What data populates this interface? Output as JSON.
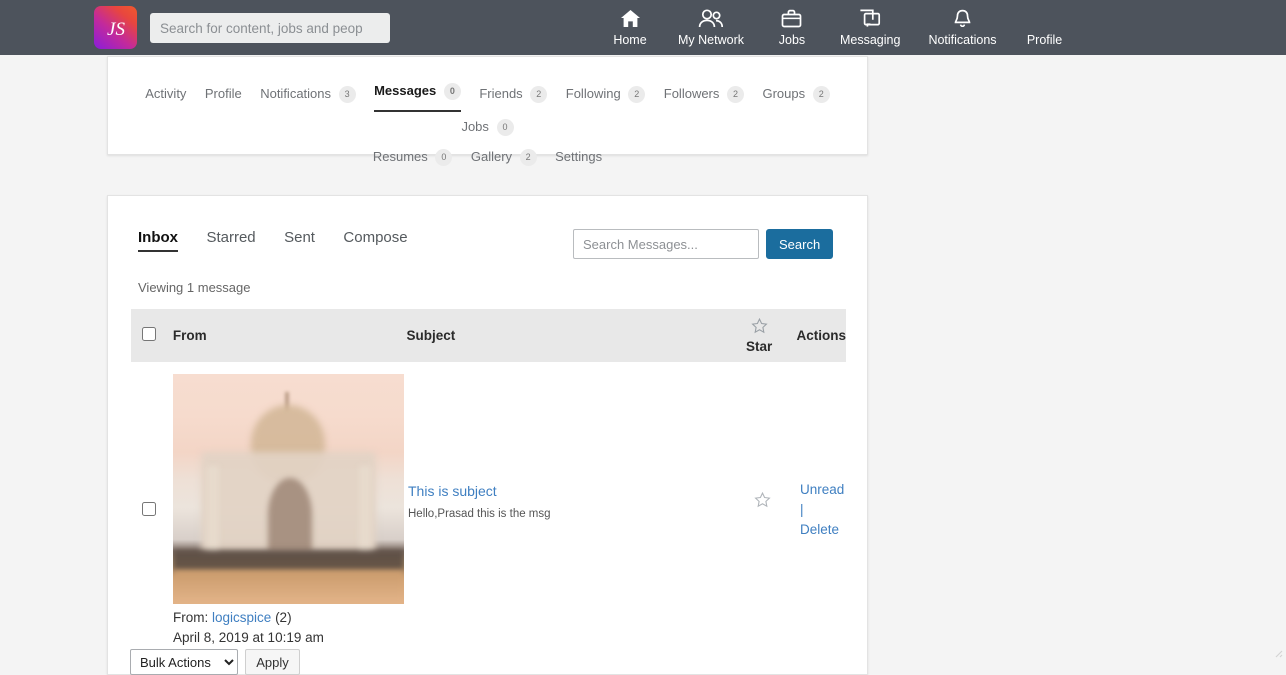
{
  "navbar": {
    "logo_text": "JS",
    "logo_name": "js-logo",
    "search_placeholder": "Search for content, jobs and peop",
    "search_value": "",
    "items": [
      {
        "label": "Home",
        "icon": "home-icon"
      },
      {
        "label": "My Network",
        "icon": "people-icon"
      },
      {
        "label": "Jobs",
        "icon": "briefcase-icon"
      },
      {
        "label": "Messaging",
        "icon": "chat-bubbles-icon"
      },
      {
        "label": "Notifications",
        "icon": "bell-icon"
      },
      {
        "label": "Profile",
        "icon": ""
      }
    ]
  },
  "profile_tabs": [
    {
      "label": "Activity",
      "count": null,
      "active": false
    },
    {
      "label": "Profile",
      "count": null,
      "active": false
    },
    {
      "label": "Notifications",
      "count": "3",
      "active": false
    },
    {
      "label": "Messages",
      "count": "0",
      "active": true
    },
    {
      "label": "Friends",
      "count": "2",
      "active": false
    },
    {
      "label": "Following",
      "count": "2",
      "active": false
    },
    {
      "label": "Followers",
      "count": "2",
      "active": false
    },
    {
      "label": "Groups",
      "count": "2",
      "active": false
    },
    {
      "label": "Jobs",
      "count": "0",
      "active": false
    },
    {
      "label": "Resumes",
      "count": "0",
      "active": false
    },
    {
      "label": "Gallery",
      "count": "2",
      "active": false
    },
    {
      "label": "Settings",
      "count": null,
      "active": false
    }
  ],
  "inbox": {
    "tabs": [
      {
        "label": "Inbox",
        "active": true
      },
      {
        "label": "Starred",
        "active": false
      },
      {
        "label": "Sent",
        "active": false
      },
      {
        "label": "Compose",
        "active": false
      }
    ],
    "search_placeholder": "Search Messages...",
    "search_value": "",
    "search_button": "Search",
    "viewing_text": "Viewing 1 message",
    "columns": {
      "from": "From",
      "subject": "Subject",
      "star": "Star",
      "actions": "Actions"
    },
    "messages": [
      {
        "from_label": "From:",
        "from_name": "logicspice",
        "from_count": "(2)",
        "date": "April 8, 2019 at 10:19 am",
        "subject": "This is subject",
        "snippet": "Hello,Prasad this is the msg",
        "starred": false,
        "action_unread": "Unread",
        "action_separator": "|",
        "action_delete": "Delete",
        "thumbnail_alt": "taj-mahal-photo"
      }
    ],
    "bulk_action_value": "Bulk Actions",
    "apply_button": "Apply"
  },
  "colors": {
    "navbar_bg": "#4d535c",
    "page_bg": "#f4f4f4",
    "link": "#3f7fc1",
    "primary_button": "#1b6d9e",
    "table_header_bg": "#e8e8e8",
    "badge_bg": "#ebebeb"
  }
}
